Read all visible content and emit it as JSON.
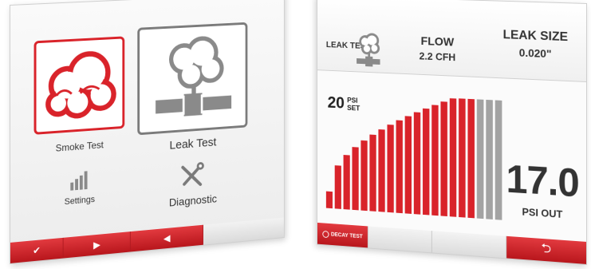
{
  "left_screen": {
    "tiles": {
      "smoke_test_label": "Smoke Test",
      "leak_test_label": "Leak Test"
    },
    "utilities": {
      "settings_label": "Settings",
      "diagnostic_label": "Diagnostic"
    },
    "bottom_bar": {
      "confirm_glyph": "✔",
      "next_glyph": "▶",
      "prev_glyph": "◀"
    },
    "icons": {
      "smoke_test": "smoke-cloud-icon",
      "leak_test": "leaking-pipe-icon",
      "settings": "bar-levels-icon",
      "diagnostic": "wrench-screwdriver-icon"
    }
  },
  "right_screen": {
    "leak_test_label": "LEAK TEST:",
    "flow": {
      "title": "FLOW",
      "value": "2.2 CFH"
    },
    "leak_size": {
      "title": "LEAK SIZE",
      "value": "0.020\""
    },
    "psi_set": {
      "value": "20",
      "label_top": "PSI",
      "label_bottom": "SET"
    },
    "psi_out": {
      "value": "17.0",
      "label": "PSI OUT"
    },
    "gauge": {
      "total_bars": 20,
      "filled_bars": 17,
      "filled_fraction": 0.85
    },
    "bottom_bar": {
      "decay_test_label": "DECAY TEST",
      "back_glyph": "⮌"
    }
  },
  "colors": {
    "accent_red": "#d9232a",
    "inactive_gray": "#a3a3a3",
    "text_dark": "#333333"
  }
}
